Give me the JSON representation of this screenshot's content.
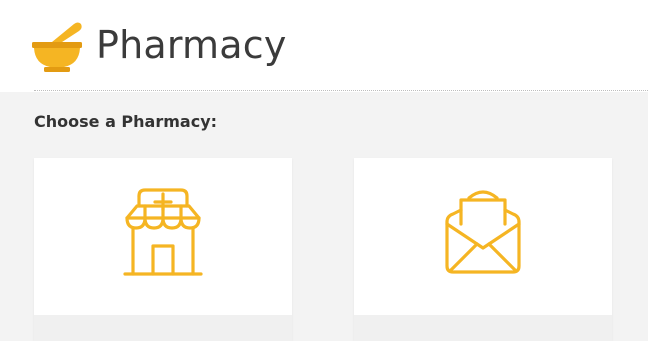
{
  "header": {
    "title": "Pharmacy",
    "logo_icon": "mortar-pestle-icon"
  },
  "section": {
    "label": "Choose a Pharmacy:"
  },
  "cards": [
    {
      "icon": "retail-pharmacy-store-icon",
      "label": ""
    },
    {
      "icon": "mail-order-envelope-icon",
      "label": ""
    }
  ],
  "colors": {
    "accent": "#f5b523",
    "accent_dark": "#e39b12",
    "title_text": "#3b3b3b",
    "background": "#f3f3f3",
    "card": "#ffffff"
  }
}
